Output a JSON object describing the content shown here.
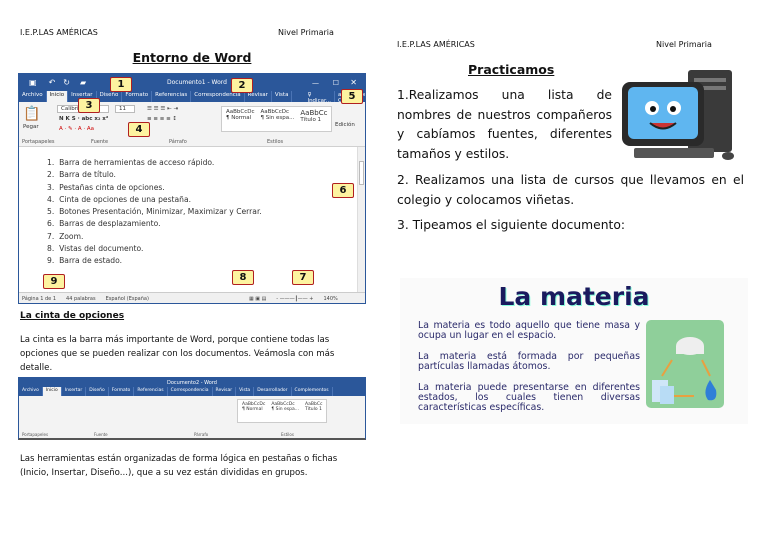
{
  "left": {
    "school": "I.E.P.LAS AMÉRICAS",
    "level": "Nivel Primaria",
    "title": "Entorno de Word",
    "word": {
      "window_title": "Documento1 - Word",
      "tabs": [
        "Archivo",
        "Inicio",
        "Insertar",
        "Diseño",
        "Formato",
        "Referencias",
        "Correspondencia",
        "Revisar",
        "Vista",
        "Desarrollador",
        "Complementos"
      ],
      "tell_me": "♀ Indicar...",
      "user": "aula Clic",
      "share": "Compartir",
      "font": "Calibri",
      "size": "11",
      "paste": "Pegar",
      "groups": [
        "Portapapeles",
        "Fuente",
        "Párrafo",
        "Estilos"
      ],
      "styles": [
        {
          "sample": "AaBbCcDc",
          "name": "¶ Normal"
        },
        {
          "sample": "AaBbCcDc",
          "name": "¶ Sin espa..."
        },
        {
          "sample": "AaBbCc",
          "name": "Título 1"
        }
      ],
      "edit": "Edición",
      "list": [
        "Barra de herramientas de acceso rápido.",
        "Barra de título.",
        "Pestañas cinta de opciones.",
        "Cinta de opciones de una pestaña.",
        "Botones  Presentación, Minimizar, Maximizar y Cerrar.",
        "Barras de desplazamiento.",
        "Zoom.",
        "Vistas del documento.",
        "Barra de estado."
      ],
      "status": {
        "page": "Página 1 de 1",
        "words": "44 palabras",
        "lang": "Español (España)",
        "zoom": "140%"
      },
      "callouts": [
        "1",
        "2",
        "3",
        "4",
        "5",
        "6",
        "7",
        "8",
        "9"
      ]
    },
    "subtitle": "La cinta de opciones",
    "para1": "La cinta es la barra más importante de Word, porque contiene todas las opciones que se pueden realizar con los documentos. Veámosla con más detalle.",
    "word2_title": "Documento2 - Word",
    "para2": "Las herramientas están organizadas de forma lógica en pestañas o fichas (Inicio, Insertar, Diseño...), que a su vez están divididas en grupos."
  },
  "right": {
    "school": "I.E.P.LAS AMÉRICAS",
    "level": "Nivel Primaria",
    "title": "Practicamos",
    "item1": "1.Realizamos una lista de nombres de nuestros compañeros y cabíamos fuentes, diferentes tamaños y estilos.",
    "item2": "2. Realizamos una lista de cursos que llevamos en el colegio y colocamos viñetas.",
    "item3": "3. Tipeamos el siguiente documento:",
    "materia": {
      "title": "La materia",
      "p1": "La materia es todo aquello que tiene masa y ocupa un lugar en el espacio.",
      "p2": "La materia está formada por pequeñas partículas llamadas átomos.",
      "p3": "La materia puede presentarse en diferentes estados, los cuales tienen diversas características específicas."
    }
  },
  "colors": {
    "word_blue": "#2b579a",
    "callout_fill": "#fdf3a0",
    "callout_border": "#b02020",
    "materia_title": "#1a1a5e",
    "materia_icon_bg": "#8fcf9a"
  }
}
